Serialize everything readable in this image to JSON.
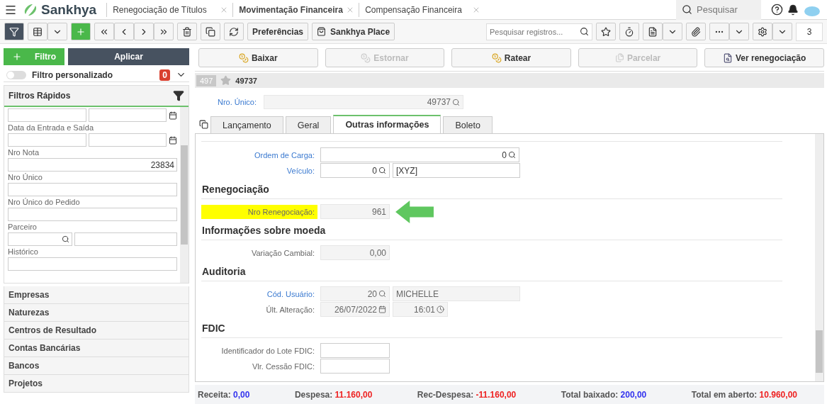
{
  "header": {
    "brand": "Sankhya",
    "tabs": [
      {
        "label": "Renegociação de Títulos",
        "selected": false
      },
      {
        "label": "Movimentação Financeira",
        "selected": true
      },
      {
        "label": "Compensação Financeira",
        "selected": false
      }
    ],
    "search": {
      "placeholder": "Pesquisar"
    }
  },
  "toolbar": {
    "buttons": [
      "Preferências",
      "Sankhya Place"
    ],
    "search": {
      "placeholder": "Pesquisar registros..."
    },
    "counter": "3"
  },
  "sidebar": {
    "add_filter": "Filtro",
    "apply": "Aplicar",
    "custom_filter": {
      "label": "Filtro personalizado",
      "on": false,
      "badge": "0"
    },
    "quick_filters": {
      "title": "Filtros Rápidos",
      "fields": [
        {
          "kind": "date_range"
        },
        {
          "kind": "date_range",
          "label": "Data da Entrada e Saída"
        },
        {
          "kind": "text",
          "label": "Nro Nota",
          "value": "23834"
        },
        {
          "kind": "text",
          "label": "Nro Único"
        },
        {
          "kind": "text",
          "label": "Nro Único do Pedido"
        },
        {
          "kind": "lookup",
          "label": "Parceiro"
        },
        {
          "kind": "text",
          "label": "Histórico"
        }
      ]
    },
    "groups": [
      "Empresas",
      "Naturezas",
      "Centros de Resultado",
      "Contas Bancárias",
      "Bancos",
      "Projetos"
    ]
  },
  "actions": [
    {
      "label": "Baixar",
      "disabled": false
    },
    {
      "label": "Estornar",
      "disabled": true
    },
    {
      "label": "Ratear",
      "disabled": false
    },
    {
      "label": "Parcelar",
      "disabled": true
    },
    {
      "label": "Ver renegociação",
      "disabled": false
    }
  ],
  "record": {
    "badge": "497",
    "favorite": false,
    "id": "49737"
  },
  "nro_unico": {
    "label": "Nro. Único:",
    "value": "49737"
  },
  "tabs": [
    {
      "label": "Lançamento",
      "selected": false
    },
    {
      "label": "Geral",
      "selected": false
    },
    {
      "label": "Outras informações",
      "selected": true
    },
    {
      "label": "Boleto",
      "selected": false
    }
  ],
  "sections": [
    {
      "rows": [
        {
          "label": "Ordem de Carga:",
          "link": true,
          "highlighted": false,
          "pointer": false,
          "inputs": [
            {
              "kind": "lookup",
              "value": "0",
              "readonly": false
            }
          ]
        },
        {
          "label": "Veículo:",
          "link": true,
          "highlighted": false,
          "pointer": false,
          "inputs": [
            {
              "kind": "lookup",
              "value": "0",
              "readonly": false
            },
            {
              "kind": "description",
              "value": "[XYZ]",
              "readonly": false
            }
          ]
        }
      ]
    },
    {
      "title": "Renegociação",
      "rows": [
        {
          "label": "Nro Renegociação:",
          "link": false,
          "highlighted": true,
          "pointer": true,
          "inputs": [
            {
              "kind": "text",
              "value": "961",
              "readonly": true
            }
          ]
        }
      ]
    },
    {
      "title": "Informações sobre moeda",
      "rows": [
        {
          "label": "Variação Cambial:",
          "link": false,
          "highlighted": false,
          "pointer": false,
          "inputs": [
            {
              "kind": "text",
              "value": "0,00",
              "readonly": true
            }
          ]
        }
      ]
    },
    {
      "title": "Auditoria",
      "rows": [
        {
          "label": "Cód. Usuário:",
          "link": true,
          "highlighted": false,
          "pointer": false,
          "inputs": [
            {
              "kind": "code",
              "value": "20",
              "readonly": true
            },
            {
              "kind": "description",
              "value": "MICHELLE",
              "readonly": true
            }
          ]
        },
        {
          "label": "Últ. Alteração:",
          "link": false,
          "highlighted": false,
          "pointer": false,
          "inputs": [
            {
              "kind": "date",
              "value": "26/07/2022",
              "readonly": true
            },
            {
              "kind": "time",
              "value": "16:01",
              "readonly": true
            }
          ]
        }
      ]
    },
    {
      "title": "FDIC",
      "rows": [
        {
          "label": "Identificador do Lote FDIC:",
          "link": false,
          "highlighted": false,
          "pointer": false,
          "inputs": [
            {
              "kind": "text",
              "readonly": false
            }
          ]
        },
        {
          "label": "Vlr. Cessão FDIC:",
          "link": false,
          "highlighted": false,
          "pointer": false,
          "inputs": [
            {
              "kind": "text",
              "readonly": false
            }
          ]
        }
      ]
    }
  ],
  "totals": [
    {
      "label": "Receita:",
      "value": "0,00",
      "color": "#3333ee"
    },
    {
      "label": "Despesa:",
      "value": "11.160,00",
      "color": "#ee2222"
    },
    {
      "label": "Rec-Despesa:",
      "value": "-11.160,00",
      "color": "#ee2222"
    },
    {
      "label": "Total baixado:",
      "value": "200,00",
      "color": "#3333ee"
    },
    {
      "label": "Total em aberto:",
      "value": "10.960,00",
      "color": "#ee2222"
    }
  ]
}
